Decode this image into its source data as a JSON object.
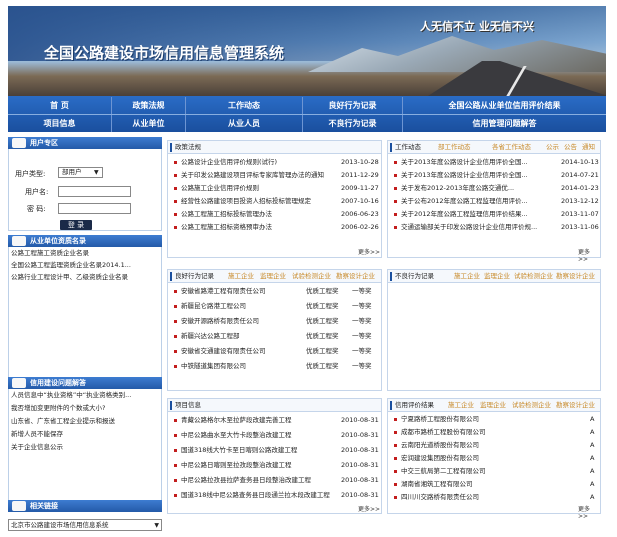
{
  "header": {
    "site_title": "全国公路建设市场信用信息管理系统",
    "slogan": "人无信不立  业无信不兴"
  },
  "nav": {
    "row1": [
      "首 页",
      "政策法规",
      "工作动态",
      "良好行为记录",
      "全国公路从业单位信用评价结果"
    ],
    "row2": [
      "项目信息",
      "从业单位",
      "从业人员",
      "不良行为记录",
      "信用管理问题解答"
    ]
  },
  "user_zone": {
    "title": "用户专区",
    "type_label": "用户类型:",
    "type_value": "部用户",
    "username_label": "用户名:",
    "password_label": "密  码:",
    "login": "登 录"
  },
  "company_query": {
    "title": "从业单位资质名录",
    "items": [
      "公路工程施工资质企业名录",
      "全国公路工程监理资质企业名录2014.1...",
      "公路行业工程设计甲、乙级资质企业名录"
    ]
  },
  "faq": {
    "title": "信用建设问题解答",
    "items": [
      "人员信息中“执业资格”中“执业资格类别...",
      "我否增加变更附件的个数或大小?",
      "山东省、广东省工程企业提示和报送",
      "新增人员不能保存",
      "关于企业信息公示"
    ]
  },
  "links": {
    "title": "相关链接",
    "selected": "北京市公路建设市场信用信息系统"
  },
  "policy": {
    "title": "政策法规",
    "more": "更多>>",
    "items": [
      {
        "t": "公路设计企业信用评价规则(试行)",
        "d": "2013-10-28"
      },
      {
        "t": "关于印发公路建设项目评标专家库管理办法的通知",
        "d": "2011-12-29"
      },
      {
        "t": "公路施工企业信用评价规则",
        "d": "2009-11-27"
      },
      {
        "t": "经营性公路建设项目投资人招标投标管理规定",
        "d": "2007-10-16"
      },
      {
        "t": "公路工程施工招标投标管理办法",
        "d": "2006-06-23"
      },
      {
        "t": "公路工程施工招标资格预审办法",
        "d": "2006-02-26"
      }
    ]
  },
  "news": {
    "title": "工作动态",
    "tabs": [
      "部工作动态",
      "各省工作动态",
      "公示",
      "公告",
      "通知"
    ],
    "more": "更多>>",
    "items": [
      {
        "t": "关于2013年度公路设计企业信用评价全国...",
        "d": "2014-10-13"
      },
      {
        "t": "关于2013年度公路设计企业信用评价全国...",
        "d": "2014-07-21"
      },
      {
        "t": "关于发布2012-2013年度公路交通优...",
        "d": "2014-01-23"
      },
      {
        "t": "关于公布2012年度公路工程监理信用评价...",
        "d": "2013-12-12"
      },
      {
        "t": "关于2012年度公路工程监理信用评价结果...",
        "d": "2013-11-07"
      },
      {
        "t": "交通运输部关于印发公路设计企业信用评价规...",
        "d": "2013-11-06"
      }
    ]
  },
  "good": {
    "title": "良好行为记录",
    "tabs": [
      "施工企业",
      "监理企业",
      "试验检测企业",
      "勘察设计企业"
    ],
    "more": "更多>>",
    "items": [
      {
        "t": "安徽省路港工程有限责任公司",
        "c": "优质工程奖",
        "g": "一等奖"
      },
      {
        "t": "新疆昆仑路港工程公司",
        "c": "优质工程奖",
        "g": "一等奖"
      },
      {
        "t": "安徽开源路桥有限责任公司",
        "c": "优质工程奖",
        "g": "一等奖"
      },
      {
        "t": "新疆兴达公路工程部",
        "c": "优质工程奖",
        "g": "一等奖"
      },
      {
        "t": "安徽省交通建设有限责任公司",
        "c": "优质工程奖",
        "g": "一等奖"
      },
      {
        "t": "中铁隧道集团有限公司",
        "c": "优质工程奖",
        "g": "一等奖"
      }
    ]
  },
  "bad": {
    "title": "不良行为记录",
    "tabs": [
      "施工企业",
      "监理企业",
      "试验检测企业",
      "勘察设计企业"
    ]
  },
  "projects": {
    "title": "项目信息",
    "more": "更多>>",
    "items": [
      {
        "t": "青藏公路格尔木至拉萨段改建完善工程",
        "d": "2010-08-31"
      },
      {
        "t": "中尼公路曲水至大竹卡段整治改建工程",
        "d": "2010-08-31"
      },
      {
        "t": "国道318线大竹卡至日喀则公路改建工程",
        "d": "2010-08-31"
      },
      {
        "t": "中尼公路日喀则至拉孜段整治改建工程",
        "d": "2010-08-31"
      },
      {
        "t": "中尼公路拉孜县拉萨查务县日段整治改建工程",
        "d": "2010-08-31"
      },
      {
        "t": "国道318线中尼公路查务县日段通兰拉木段改建工程",
        "d": "2010-08-31"
      }
    ]
  },
  "credit": {
    "title": "信用评价结果",
    "tabs": [
      "施工企业",
      "监理企业",
      "试验检测企业",
      "勘察设计企业"
    ],
    "more": "更多>>",
    "items": [
      {
        "t": "宁夏路桥工程股份有限公司",
        "g": "A"
      },
      {
        "t": "成都市路桥工程股份有限公司",
        "g": "A"
      },
      {
        "t": "云南阳光道桥股份有限公司",
        "g": "A"
      },
      {
        "t": "宏润建设集团股份有限公司",
        "g": "A"
      },
      {
        "t": "中交三航局第二工程有限公司",
        "g": "A"
      },
      {
        "t": "湖南省湘筑工程有限公司",
        "g": "A"
      },
      {
        "t": "四川川交路桥有限责任公司",
        "g": "A"
      }
    ]
  }
}
